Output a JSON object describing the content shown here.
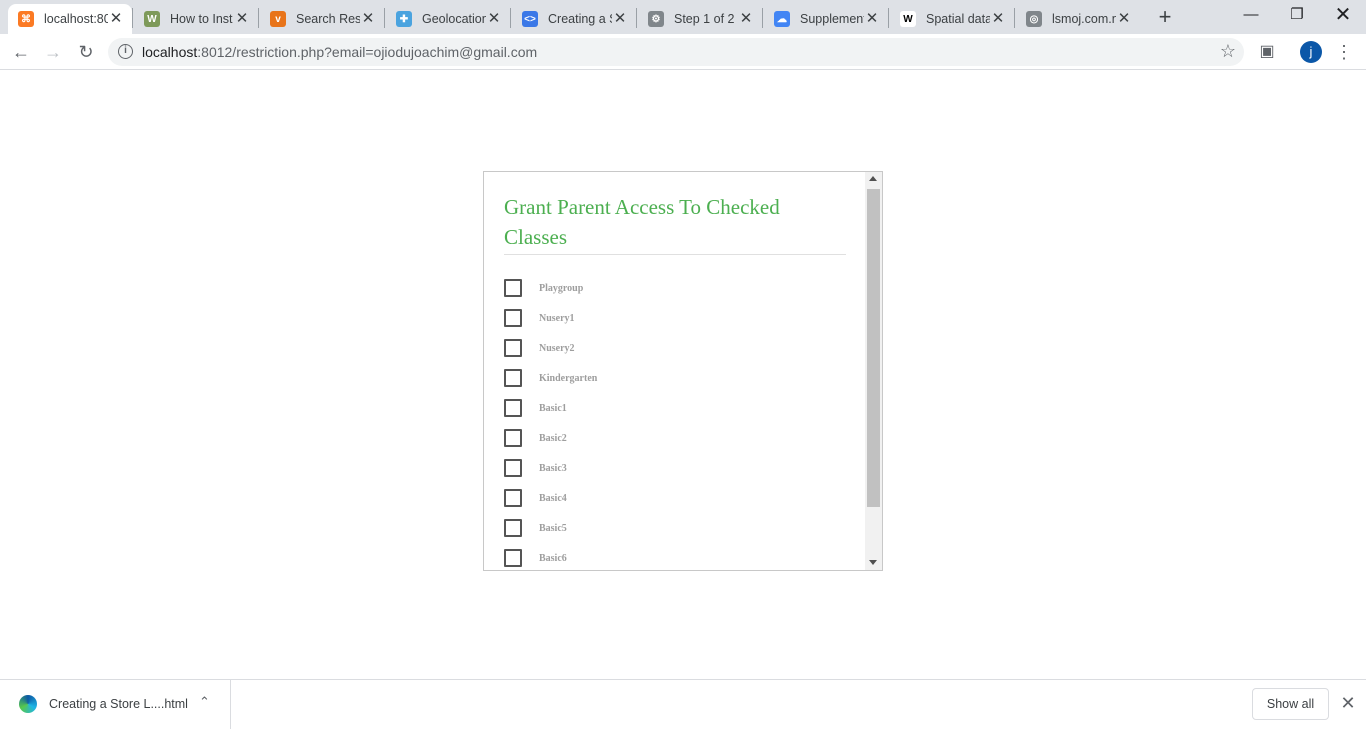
{
  "browser": {
    "tabs": [
      {
        "title": "localhost:80",
        "icon": "xampp-icon",
        "color": "#fb7a24",
        "glyph": "⌘"
      },
      {
        "title": "How to Inst",
        "icon": "wh-icon",
        "color": "#7e9a5a",
        "glyph": "W"
      },
      {
        "title": "Search Resu",
        "icon": "v-icon",
        "color": "#e8741a",
        "glyph": "v"
      },
      {
        "title": "Geolocation",
        "icon": "plus-cross-icon",
        "color": "#4aa3df",
        "glyph": "✚"
      },
      {
        "title": "Creating a S",
        "icon": "code-icon",
        "color": "#3b78e7",
        "glyph": "<>"
      },
      {
        "title": "Step 1 of 2",
        "icon": "gear-icon",
        "color": "#80868b",
        "glyph": "⚙"
      },
      {
        "title": "Supplement",
        "icon": "google-cloud-icon",
        "color": "#4285f4",
        "glyph": "☁"
      },
      {
        "title": "Spatial data",
        "icon": "wikipedia-icon",
        "color": "#ffffff",
        "glyph": "W"
      },
      {
        "title": "lsmoj.com.n",
        "icon": "globe-icon",
        "color": "#80868b",
        "glyph": "◎"
      }
    ],
    "new_tab_label": "+",
    "url_host": "localhost",
    "url_path": ":8012/restriction.php?email=ojiodujoachim@gmail.com",
    "avatar_initial": "j"
  },
  "panel": {
    "title": "Grant Parent Access To Checked Classes",
    "classes": [
      "Playgroup",
      "Nusery1",
      "Nusery2",
      "Kindergarten",
      "Basic1",
      "Basic2",
      "Basic3",
      "Basic4",
      "Basic5",
      "Basic6"
    ],
    "accent_color": "#4caf50"
  },
  "downloads": {
    "item_name": "Creating a Store L....html",
    "show_all_label": "Show all"
  }
}
